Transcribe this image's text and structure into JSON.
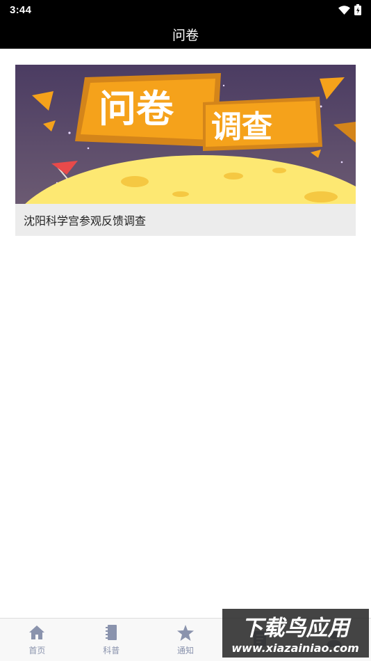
{
  "status": {
    "time": "3:44"
  },
  "header": {
    "title": "问卷"
  },
  "survey": {
    "banner_text_1": "问卷",
    "banner_text_2": "调查",
    "title": "沈阳科学宫参观反馈调查"
  },
  "tabs": [
    {
      "label": "首页",
      "icon": "home-icon"
    },
    {
      "label": "科普",
      "icon": "notebook-icon"
    },
    {
      "label": "通知",
      "icon": "star-icon"
    },
    {
      "label": "",
      "icon": "questionnaire-icon"
    },
    {
      "label": "",
      "icon": "user-icon"
    }
  ],
  "watermark": {
    "line1": "下载鸟应用",
    "line2": "www.xiazainiao.com"
  },
  "colors": {
    "accent": "#f5a21b",
    "tab_icon": "#8a93ad",
    "moon": "#fde872"
  }
}
